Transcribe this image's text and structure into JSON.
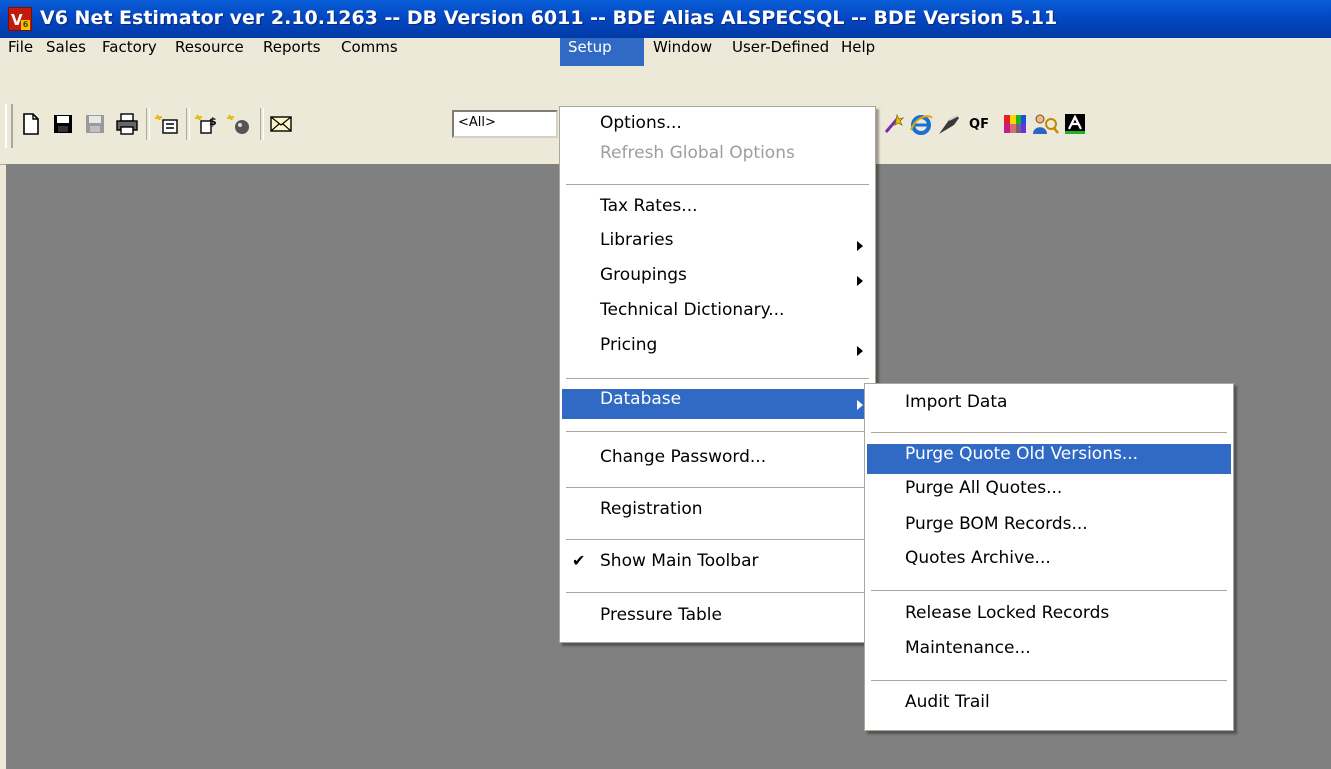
{
  "window": {
    "title": "V6 Net Estimator ver 2.10.1263 -- DB Version 6011 -- BDE Alias ALSPECSQL -- BDE Version 5.11",
    "icon_letter": "V",
    "icon_sub": "6"
  },
  "menubar": {
    "items": [
      "File",
      "Sales",
      "Factory",
      "Resource",
      "Reports",
      "Comms",
      "Setup",
      "Window",
      "User-Defined",
      "Help"
    ],
    "active": "Setup"
  },
  "toolbar": {
    "filter_value": "<All>",
    "qf_label": "QF",
    "icons": [
      "new-document-icon",
      "save-icon",
      "save-all-icon",
      "print-icon",
      "new-quote-icon",
      "new-price-icon",
      "new-wizard-icon",
      "email-icon",
      "wand-icon",
      "internet-explorer-icon",
      "tools-icon",
      "quick-find-icon",
      "color-palette-icon",
      "users-icon",
      "font-icon"
    ]
  },
  "setup_menu": {
    "items": [
      {
        "label": "Options...",
        "disabled": false
      },
      {
        "label": "Refresh Global Options",
        "disabled": true
      },
      {
        "label": "Tax Rates...",
        "disabled": false
      },
      {
        "label": "Libraries",
        "submenu": true
      },
      {
        "label": "Groupings",
        "submenu": true
      },
      {
        "label": "Technical Dictionary...",
        "disabled": false
      },
      {
        "label": "Pricing",
        "submenu": true
      },
      {
        "label": "Database",
        "submenu": true,
        "highlighted": true
      },
      {
        "label": "Change Password...",
        "disabled": false
      },
      {
        "label": "Registration",
        "disabled": false
      },
      {
        "label": "Show Main Toolbar",
        "checked": true
      },
      {
        "label": "Pressure Table",
        "disabled": false
      }
    ]
  },
  "database_menu": {
    "items": [
      {
        "label": "Import Data"
      },
      {
        "label": "Purge Quote Old Versions...",
        "highlighted": true
      },
      {
        "label": "Purge All Quotes..."
      },
      {
        "label": "Purge BOM Records..."
      },
      {
        "label": "Quotes Archive..."
      },
      {
        "label": "Release Locked Records"
      },
      {
        "label": "Maintenance..."
      },
      {
        "label": "Audit Trail"
      }
    ]
  },
  "colors": {
    "title_bar": "#0347c3",
    "menu_highlight": "#316ac5",
    "workspace": "#808080",
    "chrome": "#ece9d8"
  }
}
